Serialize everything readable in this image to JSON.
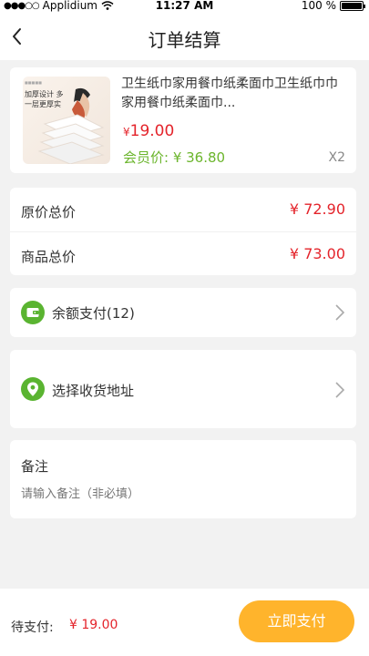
{
  "status_bar": {
    "carrier": "Applidium",
    "time": "11:27 AM",
    "battery_text": "100 %",
    "signal_icon": "signal-dots-icon",
    "wifi_icon": "wifi-icon",
    "battery_icon": "battery-icon",
    "battery_level": 1.0
  },
  "nav": {
    "title": "订单结算",
    "back_icon": "chevron-left-icon"
  },
  "product": {
    "title": "卫生纸巾家用餐巾纸柔面巾卫生纸巾巾家用餐巾纸柔面巾...",
    "price_symbol": "¥",
    "price": "19.00",
    "member_price": "会员价: ¥ 36.80",
    "quantity": "X2",
    "thumb_text": "加厚设计 多一层更厚实"
  },
  "prices": {
    "original_label": "原价总价",
    "original_value": "¥ 72.90",
    "goods_label": "商品总价",
    "goods_value": "¥ 73.00"
  },
  "payment": {
    "label": "余额支付(12)",
    "icon": "wallet-icon",
    "chevron": "chevron-right-icon"
  },
  "address": {
    "label": "选择收货地址",
    "icon": "location-pin-icon",
    "chevron": "chevron-right-icon"
  },
  "note": {
    "title": "备注",
    "placeholder": "请输入备注（非必填）"
  },
  "footer": {
    "pending_label": "待支付:",
    "pending_amount": "¥ 19.00",
    "pay_button": "立即支付"
  },
  "colors": {
    "accent": "#ffb42c",
    "price_red": "#e4242b",
    "member_green": "#6bb52c",
    "icon_green": "#5ab431",
    "background": "#f2f2f2"
  }
}
